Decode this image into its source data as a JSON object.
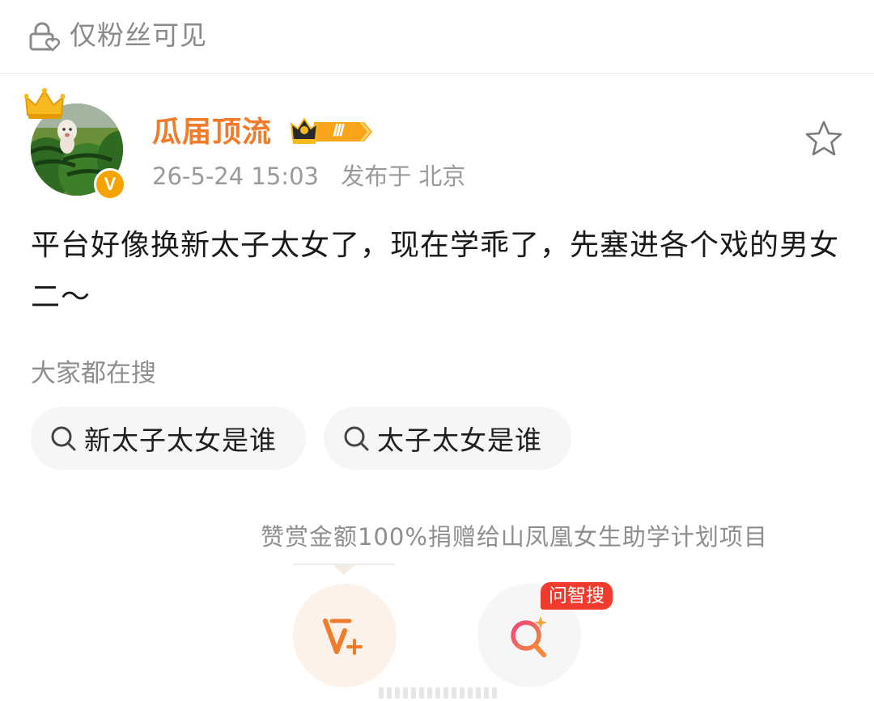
{
  "visibility": {
    "label": "仅粉丝可见",
    "icon": "lock-heart-icon"
  },
  "post": {
    "username": "瓜届顶流",
    "fan_level": "Ⅲ",
    "timestamp": "26-5-24 15:03",
    "location": "发布于 北京",
    "text": "平台好像换新太子太女了，现在学乖了，先塞进各个戏的男女二～",
    "verified_mark": "V"
  },
  "hot_search": {
    "title": "大家都在搜",
    "items": [
      {
        "label": "新太子太女是谁",
        "icon": "search-icon"
      },
      {
        "label": "太子太女是谁",
        "icon": "search-icon"
      }
    ]
  },
  "reward": {
    "note": "赞赏金额100%捐赠给山凤凰女生助学计划项目",
    "icon": "v-plus-icon"
  },
  "ask_search": {
    "tag": "问智搜",
    "icon": "sparkle-search-icon"
  },
  "colors": {
    "username": "#f07b2a",
    "accent_red": "#f23b2f",
    "verified": "#f5a300"
  }
}
